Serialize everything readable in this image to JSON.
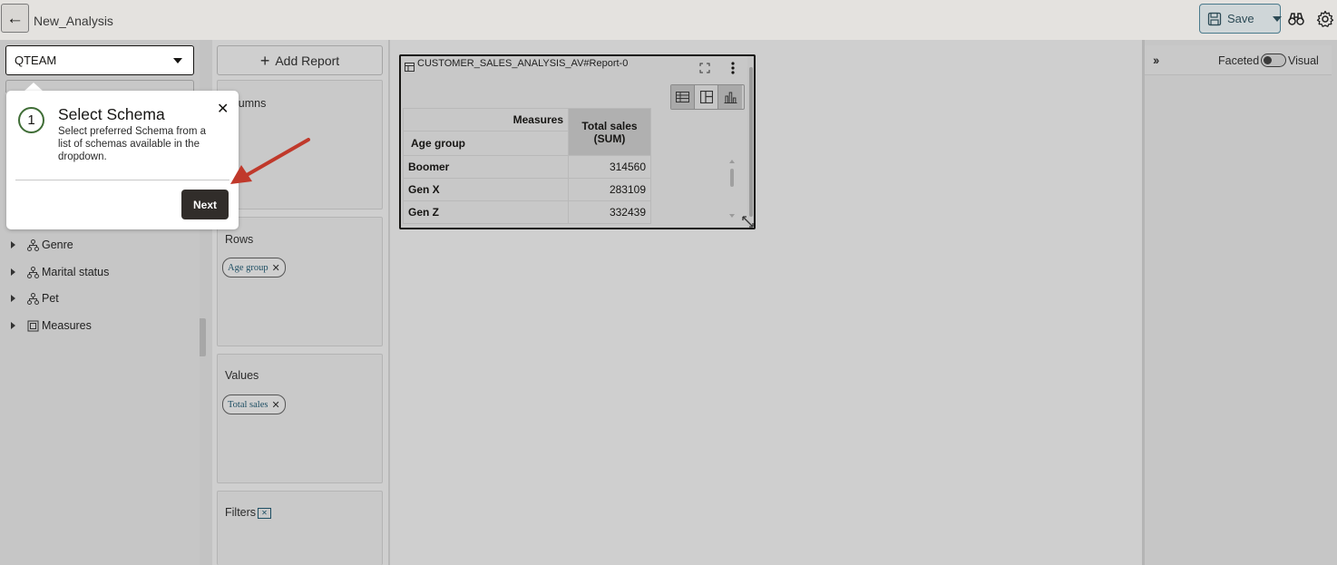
{
  "header": {
    "back_icon": "arrow-left-icon",
    "title": "New_Analysis",
    "save_label": "Save",
    "icons": [
      "save-icon",
      "binoculars-icon",
      "gear-icon"
    ]
  },
  "left_panel": {
    "schema_select": {
      "value": "QTEAM"
    },
    "tree": [
      {
        "label": "Genre",
        "icon": "hierarchy-icon"
      },
      {
        "label": "Marital status",
        "icon": "hierarchy-icon"
      },
      {
        "label": "Pet",
        "icon": "hierarchy-icon"
      },
      {
        "label": "Measures",
        "icon": "measures-icon"
      }
    ]
  },
  "middle": {
    "add_report_label": "Add Report",
    "columns_title": "Columns",
    "columns_title_visible": "lumns",
    "rows_title": "Rows",
    "rows_chips": [
      "Age group"
    ],
    "values_title": "Values",
    "values_chips": [
      "Total sales"
    ],
    "filters_title": "Filters"
  },
  "report": {
    "title": "CUSTOMER_SALES_ANALYSIS_AV#Report-0",
    "header_measures": "Measures",
    "header_total": "Total sales",
    "header_total_sub": "(SUM)",
    "row_header": "Age group",
    "rows": [
      {
        "label": "Boomer",
        "value": "314560"
      },
      {
        "label": "Gen X",
        "value": "283109"
      },
      {
        "label": "Gen Z",
        "value": "332439"
      }
    ]
  },
  "right_panel": {
    "expand_label": "››",
    "faceted_label": "Faceted",
    "visual_label": "Visual"
  },
  "tour_popup": {
    "step": "1",
    "title": "Select Schema",
    "description": "Select preferred Schema from a list of schemas available in the dropdown.",
    "next_label": "Next",
    "arrow_color": "#c0392b"
  }
}
